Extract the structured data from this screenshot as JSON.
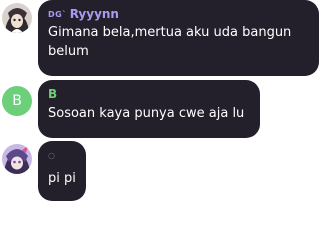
{
  "messages": [
    {
      "sender_tag": "DG`",
      "sender_name": "Ryyynn",
      "sender_color": "#a99cf0",
      "text_line1": "Gimana bela,mertua aku uda bangun",
      "text_line2": "belum",
      "avatar": "anime-character-avatar"
    },
    {
      "sender_name": "B",
      "sender_color": "#6fcf74",
      "avatar_letter": "B",
      "avatar_color": "#6ccf7a",
      "text": "Sosoan kaya punya cwe aja lu"
    },
    {
      "sender_name": "",
      "sender_status": "○",
      "text": "pi pi",
      "avatar": "anime-character-avatar-purple"
    }
  ]
}
